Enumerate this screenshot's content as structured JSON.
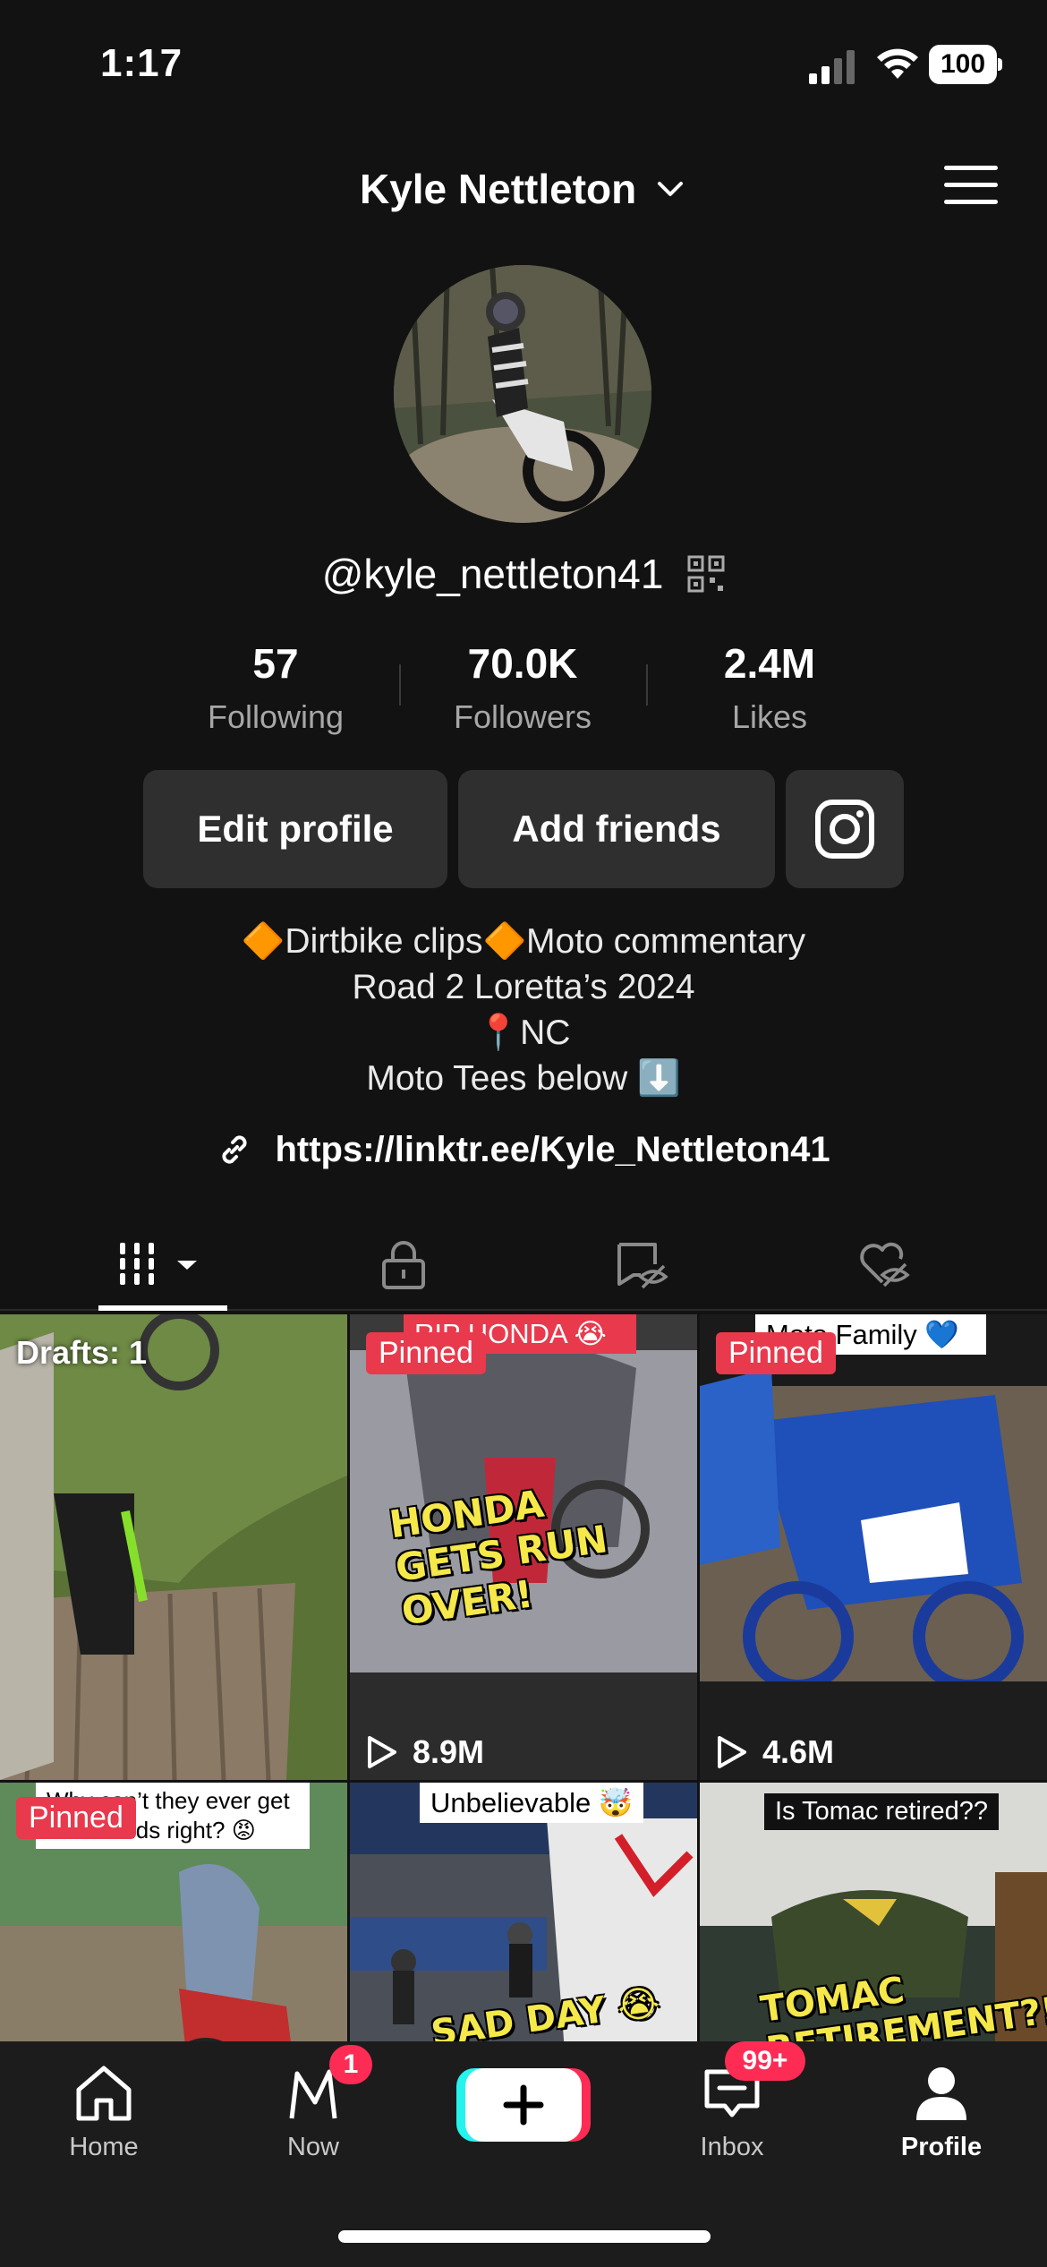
{
  "status_bar": {
    "time": "1:17",
    "battery": "100"
  },
  "header": {
    "title": "Kyle Nettleton"
  },
  "profile": {
    "handle": "@kyle_nettleton41",
    "stats": [
      {
        "value": "57",
        "label": "Following"
      },
      {
        "value": "70.0K",
        "label": "Followers"
      },
      {
        "value": "2.4M",
        "label": "Likes"
      }
    ],
    "buttons": {
      "edit": "Edit profile",
      "add_friends": "Add friends"
    },
    "bio": [
      "🔶Dirtbike clips🔶Moto commentary",
      "Road 2 Loretta’s 2024",
      "📍NC",
      "Moto Tees below ⬇️"
    ],
    "link": "https://linktr.ee/Kyle_Nettleton41"
  },
  "tabs": [
    "videos",
    "private",
    "reposts-hidden",
    "liked-hidden"
  ],
  "grid": [
    {
      "drafts": "Drafts: 1"
    },
    {
      "pinned": "Pinned",
      "top_caption": "RIP HONDA 😭",
      "overlay": "HONDA GETS RUN OVER!",
      "views": "8.9M"
    },
    {
      "pinned": "Pinned",
      "top_caption": "Moto Family 💙",
      "views": "4.6M"
    },
    {
      "pinned": "Pinned",
      "top_caption": "Why can’t they ever get the sounds right? 😡"
    },
    {
      "top_caption": "Unbelievable 🤯",
      "overlay": "SAD DAY 😭"
    },
    {
      "top_caption": "Is Tomac retired??",
      "overlay": "TOMAC RETIREMENT?!"
    }
  ],
  "bottom_nav": {
    "home": "Home",
    "now": "Now",
    "now_badge": "1",
    "inbox": "Inbox",
    "inbox_badge": "99+",
    "profile": "Profile"
  },
  "colors": {
    "accent_red": "#fe2c55",
    "pinned_red": "#e8394d",
    "background": "#121212",
    "button_bg": "#2f2f2f"
  }
}
